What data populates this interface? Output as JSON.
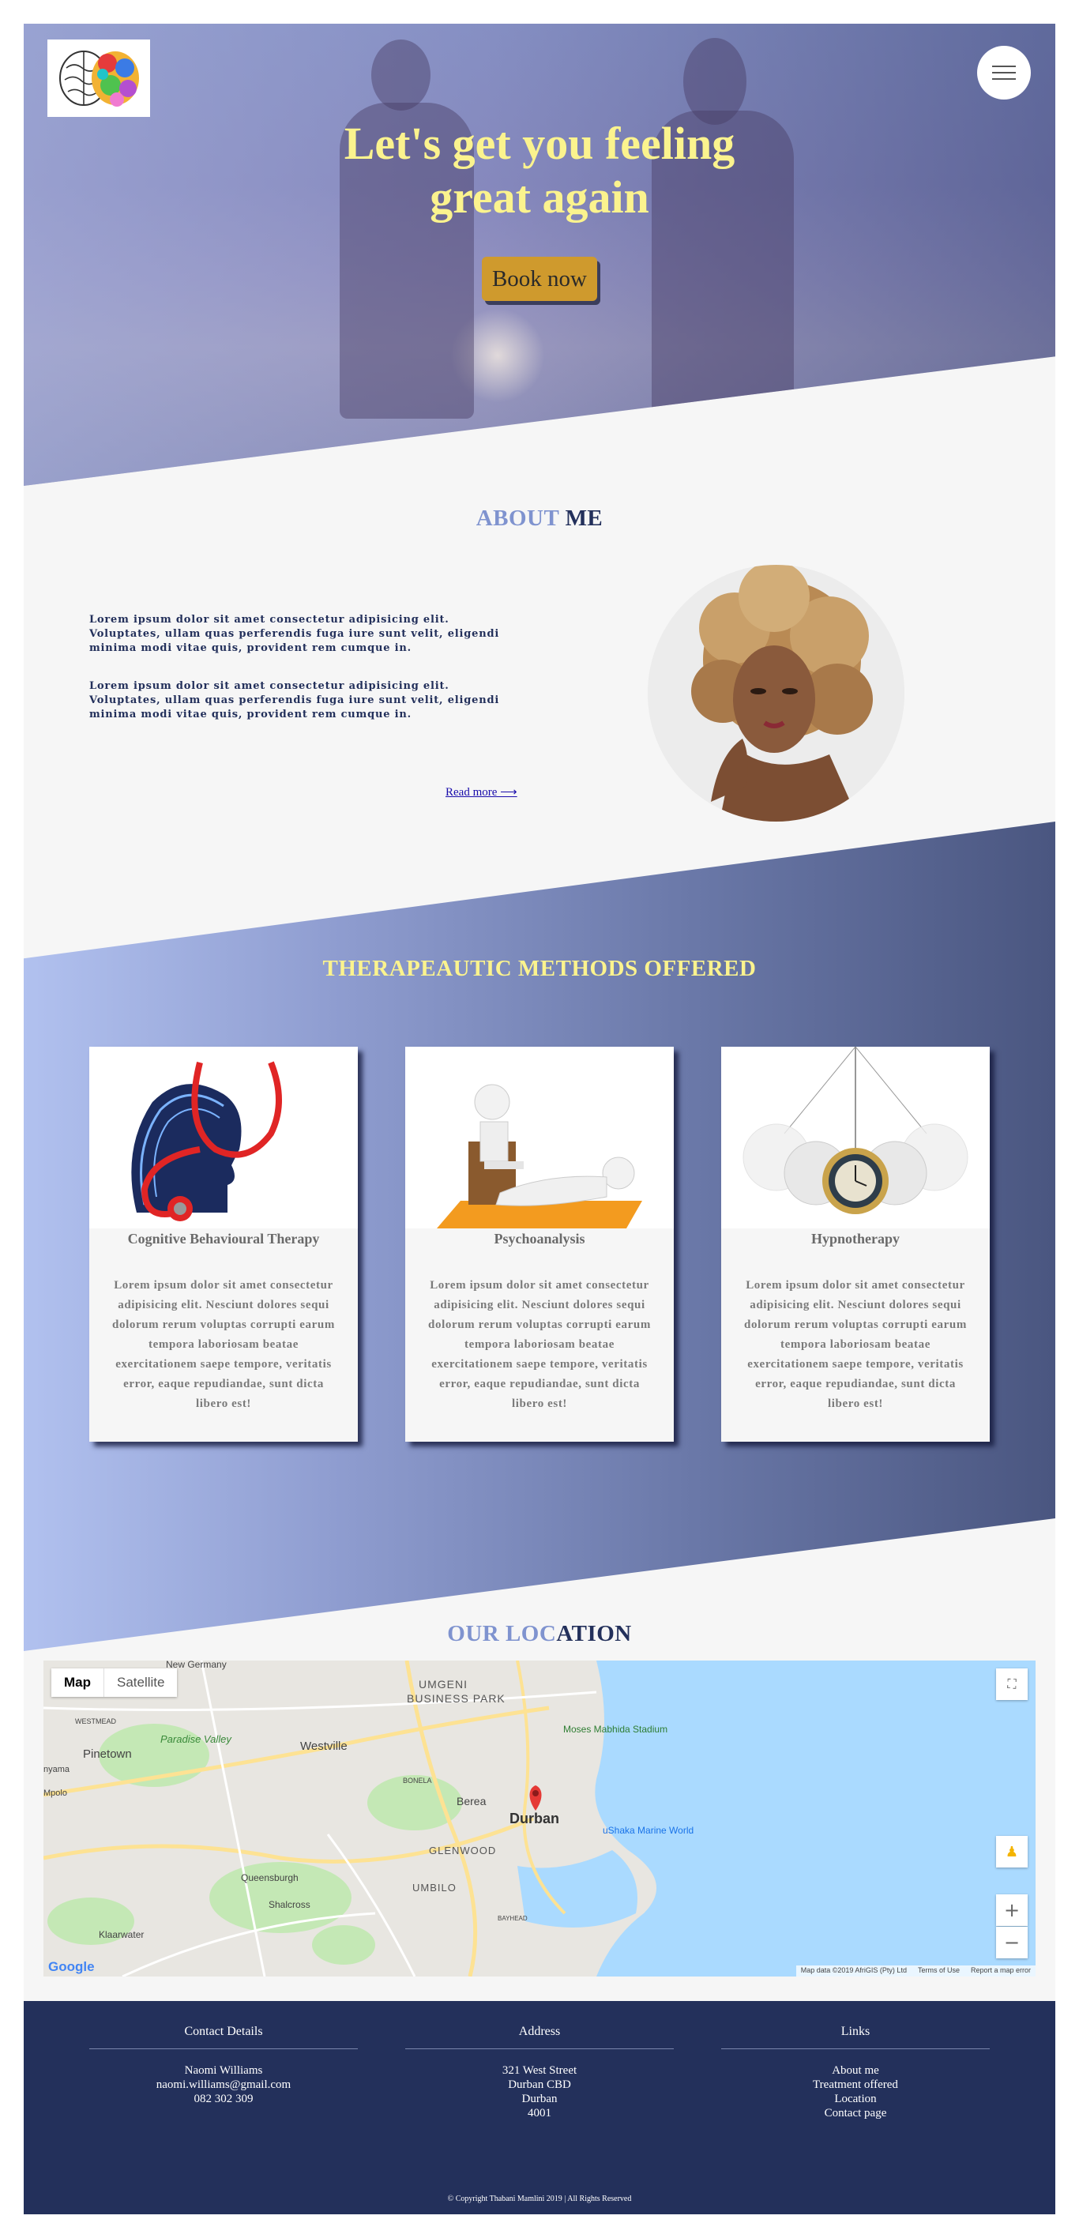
{
  "hero": {
    "title": "Let's get you feeling great again",
    "book_button": "Book now"
  },
  "about": {
    "title_part1": "ABOUT",
    "title_part2": " ME",
    "paragraph1": "Lorem ipsum dolor sit amet consectetur adipisicing elit. Voluptates, ullam quas perferendis fuga iure sunt velit, eligendi minima modi vitae quis, provident rem cumque in.",
    "paragraph2": "Lorem ipsum dolor sit amet consectetur adipisicing elit. Voluptates, ullam quas perferendis fuga iure sunt velit, eligendi minima modi vitae quis, provident rem cumque in.",
    "read_more": "Read more ⟶"
  },
  "methods": {
    "title": "THERAPEAUTIC METHODS OFFERED",
    "cards": [
      {
        "title": "Cognitive Behavioural Therapy",
        "description": "Lorem ipsum dolor sit amet consectetur adipisicing elit. Nesciunt dolores sequi dolorum rerum voluptas corrupti earum tempora laboriosam beatae exercitationem saepe tempore, veritatis error, eaque repudiandae, sunt dicta libero est!"
      },
      {
        "title": "Psychoanalysis",
        "description": "Lorem ipsum dolor sit amet consectetur adipisicing elit. Nesciunt dolores sequi dolorum rerum voluptas corrupti earum tempora laboriosam beatae exercitationem saepe tempore, veritatis error, eaque repudiandae, sunt dicta libero est!"
      },
      {
        "title": "Hypnotherapy",
        "description": "Lorem ipsum dolor sit amet consectetur adipisicing elit. Nesciunt dolores sequi dolorum rerum voluptas corrupti earum tempora laboriosam beatae exercitationem saepe tempore, veritatis error, eaque repudiandae, sunt dicta libero est!"
      }
    ]
  },
  "location": {
    "title_part1": "OUR LOC",
    "title_part2": "ATION",
    "map": {
      "tab_map": "Map",
      "tab_satellite": "Satellite",
      "labels": {
        "umgeni": "UMGENI",
        "business_park": "BUSINESS PARK",
        "westville": "Westville",
        "pinetown": "Pinetown",
        "paradise_valley": "Paradise Valley",
        "westmead": "WESTMEAD",
        "new_germany": "New Germany",
        "bonela": "BONELA",
        "berea": "Berea",
        "durban": "Durban",
        "glenwood": "GLENWOOD",
        "queensburgh": "Queensburgh",
        "shalcross": "Shalcross",
        "umbilo": "UMBILO",
        "klaarwater": "Klaarwater",
        "bayhead": "BAYHEAD",
        "moses_mabhida": "Moses Mabhida Stadium",
        "ushaka": "uShaka Marine World",
        "nyama": "nyama",
        "mpolo": "Mpolo",
        "google": "Google"
      },
      "footer": {
        "data": "Map data ©2019 AfriGIS (Pty) Ltd",
        "terms": "Terms of Use",
        "report": "Report a map error"
      },
      "zoom_in": "+",
      "zoom_out": "−",
      "colors": {
        "water": "#aadaff",
        "land": "#e8e6e1",
        "park": "#c4e8b5",
        "road": "#fde293"
      }
    }
  },
  "footer": {
    "contact": {
      "heading": "Contact Details",
      "name": "Naomi Williams",
      "email": "naomi.williams@gmail.com",
      "phone": "082 302 309"
    },
    "address": {
      "heading": "Address",
      "line1": "321 West Street",
      "line2": "Durban CBD",
      "line3": "Durban",
      "line4": "4001"
    },
    "links": {
      "heading": "Links",
      "items": [
        "About me",
        "Treatment offered",
        "Location",
        "Contact page"
      ]
    },
    "copyright": "© Copyright Thabani Mamlini 2019 | All Rights Reserved"
  },
  "colors": {
    "hero_title": "#fbf38e",
    "book_button": "#cf9a2d",
    "title_light": "#7f93cf",
    "title_dark": "#23305b",
    "footer_bg": "#23305b"
  }
}
